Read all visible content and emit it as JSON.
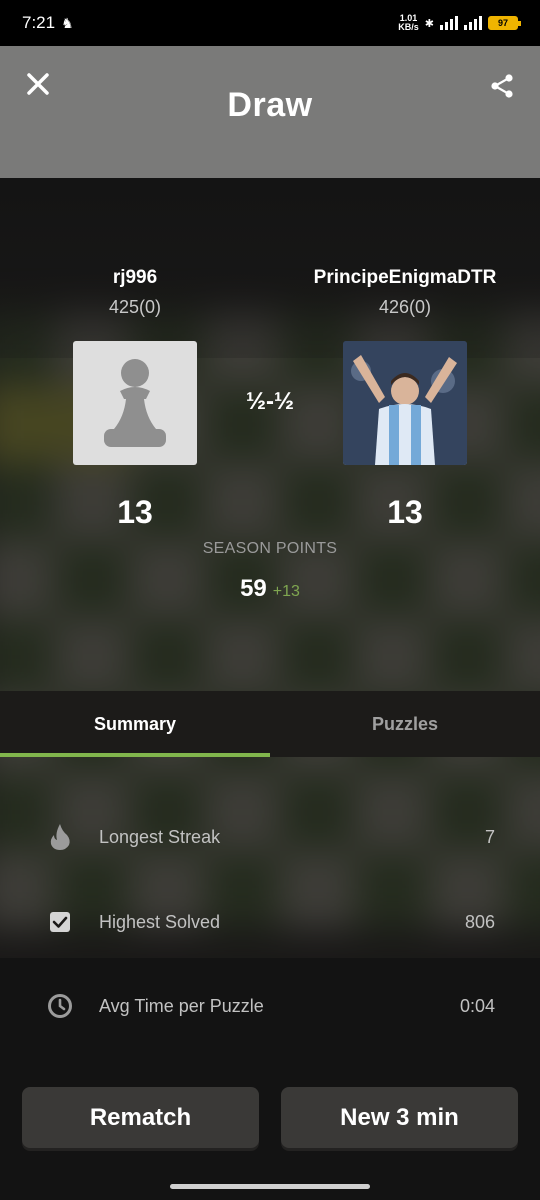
{
  "status_bar": {
    "time": "7:21",
    "net_speed_value": "1.01",
    "net_speed_unit": "KB/s",
    "battery": "97"
  },
  "header": {
    "title": "Draw"
  },
  "players": [
    {
      "name": "rj996",
      "rating": "425(0)",
      "points": "13"
    },
    {
      "name": "PrincipeEnigmaDTR",
      "rating": "426(0)",
      "points": "13"
    }
  ],
  "result": "½-½",
  "season": {
    "label": "SEASON POINTS",
    "value": "59",
    "delta": "+13"
  },
  "tabs": [
    {
      "label": "Summary",
      "active": true
    },
    {
      "label": "Puzzles",
      "active": false
    }
  ],
  "stats": [
    {
      "label": "Longest Streak",
      "value": "7",
      "icon": "flame-icon"
    },
    {
      "label": "Highest Solved",
      "value": "806",
      "icon": "checkbox-icon"
    },
    {
      "label": "Avg Time per Puzzle",
      "value": "0:04",
      "icon": "clock-icon"
    }
  ],
  "buttons": {
    "rematch": "Rematch",
    "new_game": "New 3 min"
  },
  "colors": {
    "accent": "#81b64c",
    "header_bg": "#7a7a79",
    "button_bg": "#3a3937"
  }
}
